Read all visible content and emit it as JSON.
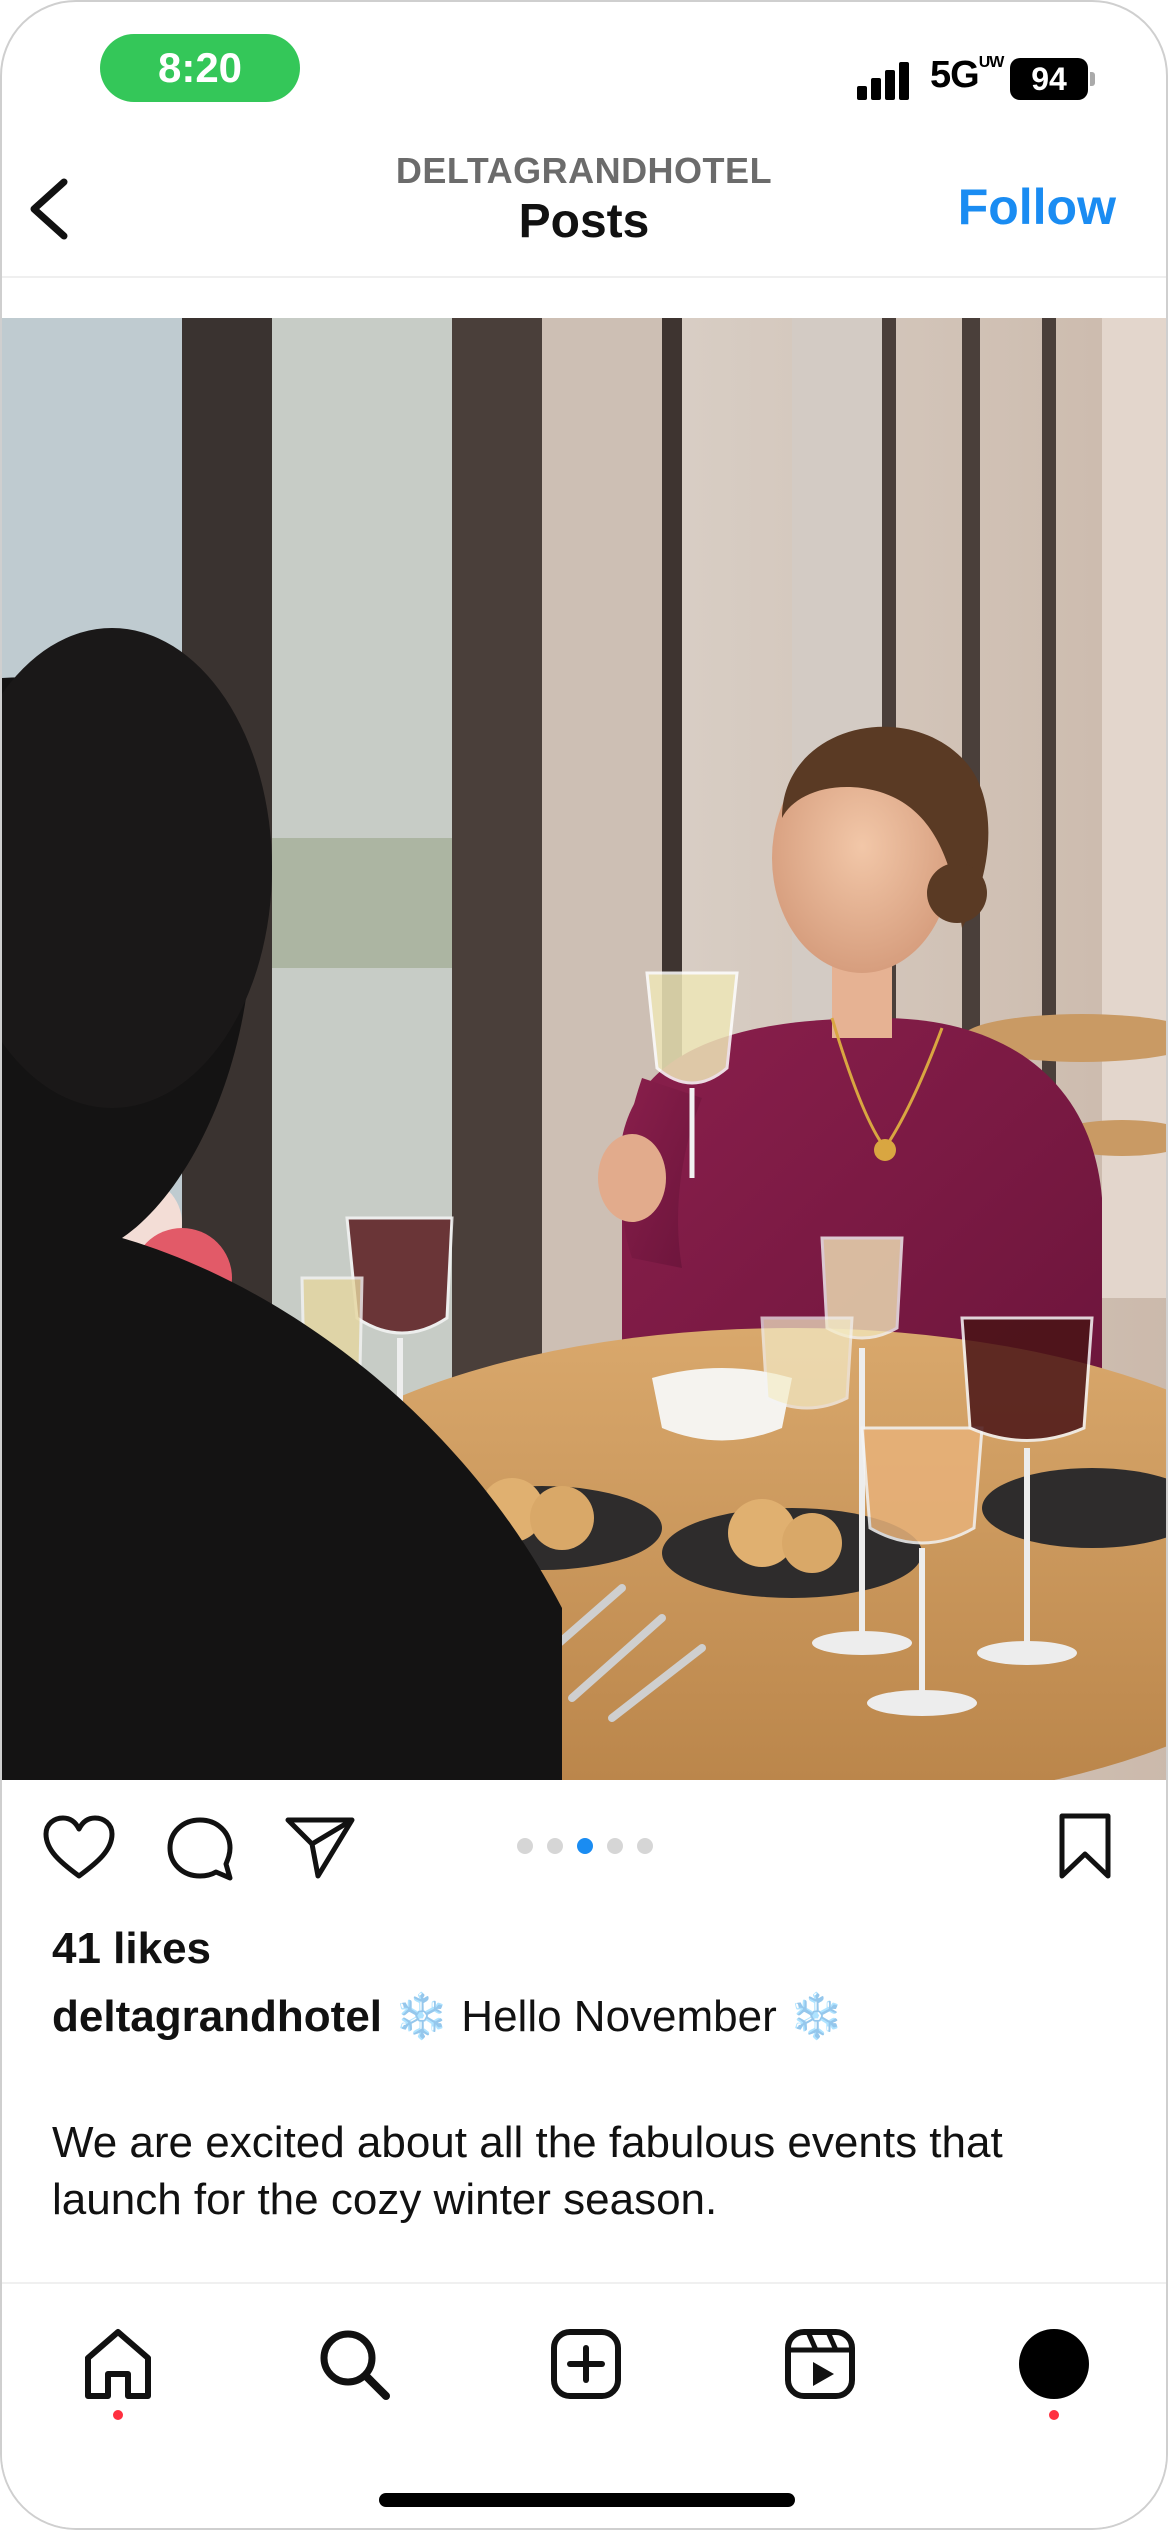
{
  "status_bar": {
    "time": "8:20",
    "network": "5G",
    "network_super": "UW",
    "battery": "94"
  },
  "header": {
    "username": "DELTAGRANDHOTEL",
    "title": "Posts",
    "follow_label": "Follow"
  },
  "post": {
    "carousel": {
      "count": 5,
      "active_index": 2
    },
    "likes": "41 likes",
    "caption": {
      "username": "deltagrandhotel",
      "emoji": "❄️",
      "headline": "Hello November",
      "body": "We are excited about all the fabulous events that launch for the cozy winter season."
    }
  },
  "icons": {
    "back": "chevron-left-icon",
    "like": "heart-icon",
    "comment": "comment-bubble-icon",
    "share": "paper-plane-icon",
    "save": "bookmark-icon",
    "home": "home-icon",
    "search": "search-icon",
    "create": "plus-square-icon",
    "reels": "reels-icon",
    "profile": "profile-avatar-icon"
  },
  "colors": {
    "accent": "#1a8cf2",
    "status_pill": "#34c759",
    "notification_dot": "#ff3040"
  }
}
